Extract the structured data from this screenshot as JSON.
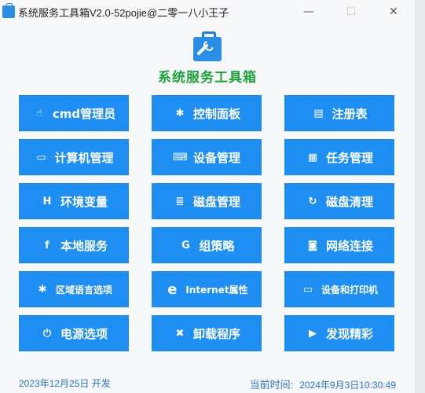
{
  "window": {
    "title": "系统服务工具箱V2.0-52pojie@二零一八小王子",
    "controls": {
      "minimize": "—",
      "maximize": "☐",
      "close": "✕"
    }
  },
  "header": {
    "title": "系统服务工具箱"
  },
  "buttons": [
    {
      "id": "cmd",
      "label": "cmd管理员",
      "icon": "☝"
    },
    {
      "id": "control-panel",
      "label": "控制面板",
      "icon": "✱"
    },
    {
      "id": "registry",
      "label": "注册表",
      "icon": "▤"
    },
    {
      "id": "computer-management",
      "label": "计算机管理",
      "icon": "▭"
    },
    {
      "id": "device-management",
      "label": "设备管理",
      "icon": "⌨"
    },
    {
      "id": "task-management",
      "label": "任务管理",
      "icon": "▦"
    },
    {
      "id": "environment-variables",
      "label": "环境变量",
      "icon": "H"
    },
    {
      "id": "disk-management",
      "label": "磁盘管理",
      "icon": "≣"
    },
    {
      "id": "disk-cleanup",
      "label": "磁盘清理",
      "icon": "↻"
    },
    {
      "id": "local-services",
      "label": "本地服务",
      "icon": "f"
    },
    {
      "id": "group-policy",
      "label": "组策略",
      "icon": "G"
    },
    {
      "id": "network-connections",
      "label": "网络连接",
      "icon": "◙"
    },
    {
      "id": "region-language",
      "label": "区域语言选项",
      "icon": "✱"
    },
    {
      "id": "internet-properties",
      "label": "Internet属性",
      "icon": "e"
    },
    {
      "id": "devices-printers",
      "label": "设备和打印机",
      "icon": "▭"
    },
    {
      "id": "power-options",
      "label": "电源选项",
      "icon": "⏻"
    },
    {
      "id": "uninstall-programs",
      "label": "卸载程序",
      "icon": "✖"
    },
    {
      "id": "discover",
      "label": "发现精彩",
      "icon": "▶"
    }
  ],
  "footer": {
    "dev_date": "2023年12月25日 开发",
    "current_time_label": "当前时间:",
    "current_time": "2024年9月3日10:30:49"
  }
}
